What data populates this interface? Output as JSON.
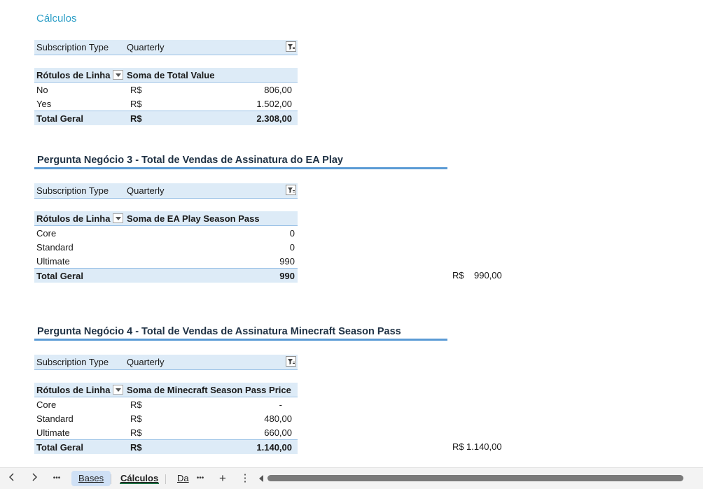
{
  "sheet_title": "Cálculos",
  "block1": {
    "filter": {
      "label": "Subscription Type",
      "value": "Quarterly"
    },
    "header": {
      "col1": "Rótulos de Linha",
      "col2": "Soma de Total Value"
    },
    "rows": [
      {
        "label": "No",
        "currency": "R$",
        "value": "806,00"
      },
      {
        "label": "Yes",
        "currency": "R$",
        "value": "1.502,00"
      }
    ],
    "total": {
      "label": "Total Geral",
      "currency": "R$",
      "value": "2.308,00"
    }
  },
  "block2": {
    "title": "Pergunta Negócio 3 - Total de Vendas de Assinatura do EA Play",
    "filter": {
      "label": "Subscription Type",
      "value": "Quarterly"
    },
    "header": {
      "col1": "Rótulos de Linha",
      "col2": "Soma de EA Play Season Pass"
    },
    "rows": [
      {
        "label": "Core",
        "value": "0"
      },
      {
        "label": "Standard",
        "value": "0"
      },
      {
        "label": "Ultimate",
        "value": "990"
      }
    ],
    "total": {
      "label": "Total Geral",
      "value": "990"
    },
    "side": {
      "currency": "R$",
      "value": "990,00"
    }
  },
  "block3": {
    "title": "Pergunta Negócio 4 - Total de Vendas de Assinatura Minecraft Season Pass",
    "filter": {
      "label": "Subscription Type",
      "value": "Quarterly"
    },
    "header": {
      "col1": "Rótulos de Linha",
      "col2": "Soma de Minecraft Season Pass Price"
    },
    "rows": [
      {
        "label": "Core",
        "currency": "R$",
        "value": "-"
      },
      {
        "label": "Standard",
        "currency": "R$",
        "value": "480,00"
      },
      {
        "label": "Ultimate",
        "currency": "R$",
        "value": "660,00"
      }
    ],
    "total": {
      "label": "Total Geral",
      "currency": "R$",
      "value": "1.140,00"
    },
    "side": {
      "currency": "R$",
      "value": "1.140,00"
    }
  },
  "tabbar": {
    "prev_icon": "chevron-left-icon",
    "next_icon": "chevron-right-icon",
    "more_symbol": "•••",
    "tabs": [
      {
        "label": "Bases"
      },
      {
        "label": "Cálculos",
        "active": true
      },
      {
        "label": "Da"
      }
    ],
    "add_symbol": "+",
    "menu_symbol": "⋮"
  }
}
